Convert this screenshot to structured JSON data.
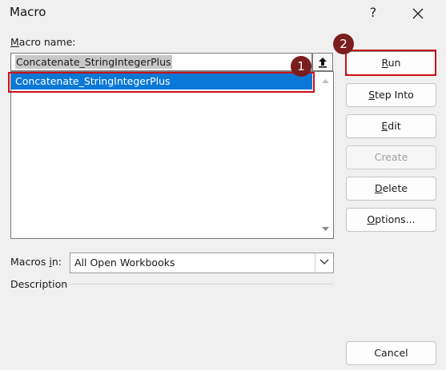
{
  "window": {
    "title": "Macro",
    "help_glyph": "?"
  },
  "macro_name": {
    "label_mnemonic": "M",
    "label_rest": "acro name:",
    "value": "Concatenate_StringIntegerPlus"
  },
  "macro_list": {
    "items": [
      "Concatenate_StringIntegerPlus"
    ],
    "selected_index": 0
  },
  "buttons": {
    "run": {
      "mnemonic": "R",
      "rest": "un"
    },
    "step_into": {
      "mnemonic": "S",
      "rest": "tep Into"
    },
    "edit": {
      "mnemonic": "E",
      "rest": "dit"
    },
    "create": {
      "label": "Create",
      "enabled": false
    },
    "delete": {
      "mnemonic": "D",
      "rest": "elete"
    },
    "options": {
      "mnemonic": "O",
      "rest": "ptions..."
    },
    "cancel": "Cancel"
  },
  "macros_in": {
    "label_pre": "Macros ",
    "label_mnemonic": "i",
    "label_post": "n:",
    "value": "All Open Workbooks"
  },
  "description": {
    "label": "Description"
  },
  "callouts": [
    "1",
    "2"
  ],
  "colors": {
    "selection": "#0a78d7",
    "callout_border": "#c8101a",
    "badge": "#7b1e1e"
  }
}
